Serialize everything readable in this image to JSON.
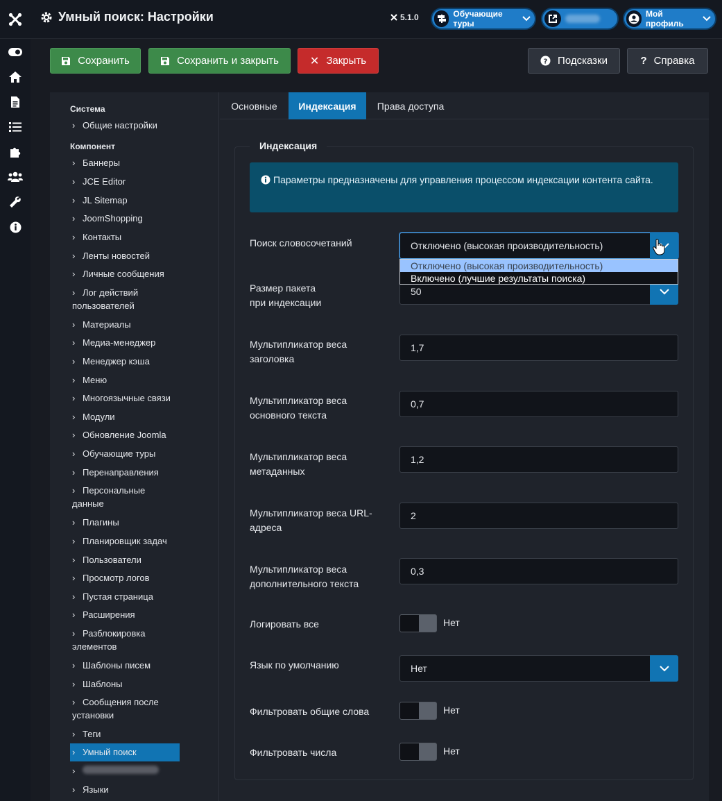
{
  "header": {
    "title": "Умный поиск: Настройки",
    "version": "5.1.0",
    "tours_label": "Обучающие туры",
    "profile_label": "Мой профиль"
  },
  "toolbar": {
    "save": "Сохранить",
    "save_close": "Сохранить и закрыть",
    "close": "Закрыть",
    "hints": "Подсказки",
    "help": "Справка"
  },
  "sidebar": {
    "system_heading": "Система",
    "system_items": [
      "Общие настройки"
    ],
    "component_heading": "Компонент",
    "items": [
      "Баннеры",
      "JCE Editor",
      "JL Sitemap",
      "JoomShopping",
      "Контакты",
      "Ленты новостей",
      "Личные сообщения",
      "Лог действий пользователей",
      "Материалы",
      "Медиа-менеджер",
      "Менеджер кэша",
      "Меню",
      "Многоязычные связи",
      "Модули",
      "Обновление Joomla",
      "Обучающие туры",
      "Перенаправления",
      "Персональные данные",
      "Плагины",
      "Планировщик задач",
      "Пользователи",
      "Просмотр логов",
      "Пустая страница",
      "Расширения",
      "Разблокировка элементов",
      "Шаблоны писем",
      "Шаблоны",
      "Сообщения после установки",
      "Теги",
      "Умный поиск",
      "",
      "Языки"
    ],
    "active": "Умный поиск"
  },
  "tabs": [
    "Основные",
    "Индексация",
    "Права доступа"
  ],
  "active_tab": "Индексация",
  "section": {
    "legend": "Индексация",
    "alert": "Параметры предназначены для управления процессом индексации контента сайта."
  },
  "fields": {
    "phrase_search_label": "Поиск словосочетаний",
    "phrase_search_value": "Отключено (высокая производительность)",
    "phrase_search_options": [
      "Отключено (высокая производительность)",
      "Включено (лучшие результаты поиска)"
    ],
    "batch_size_label_1": "Размер пакета",
    "batch_size_label_2": "при индексации",
    "batch_size_value": "50",
    "title_mult_label_1": "Мультипликатор веса",
    "title_mult_label_2": "заголовка",
    "title_mult_value": "1,7",
    "body_mult_label_1": "Мультипликатор веса",
    "body_mult_label_2": "основного текста",
    "body_mult_value": "0,7",
    "meta_mult_label_1": "Мультипликатор веса",
    "meta_mult_label_2": "метаданных",
    "meta_mult_value": "1,2",
    "url_mult_label_1": "Мультипликатор веса URL-",
    "url_mult_label_2": "адреса",
    "url_mult_value": "2",
    "misc_mult_label_1": "Мультипликатор веса",
    "misc_mult_label_2": "дополнительного текста",
    "misc_mult_value": "0,3",
    "log_all_label": "Логировать все",
    "log_all_value": "Нет",
    "default_lang_label": "Язык по умолчанию",
    "default_lang_value": "Нет",
    "filter_common_label": "Фильтровать общие слова",
    "filter_common_value": "Нет",
    "filter_numeric_label": "Фильтровать числа",
    "filter_numeric_value": "Нет"
  },
  "colors": {
    "accent": "#1174b3",
    "green": "#3d8a4a",
    "red": "#c52b2b"
  }
}
